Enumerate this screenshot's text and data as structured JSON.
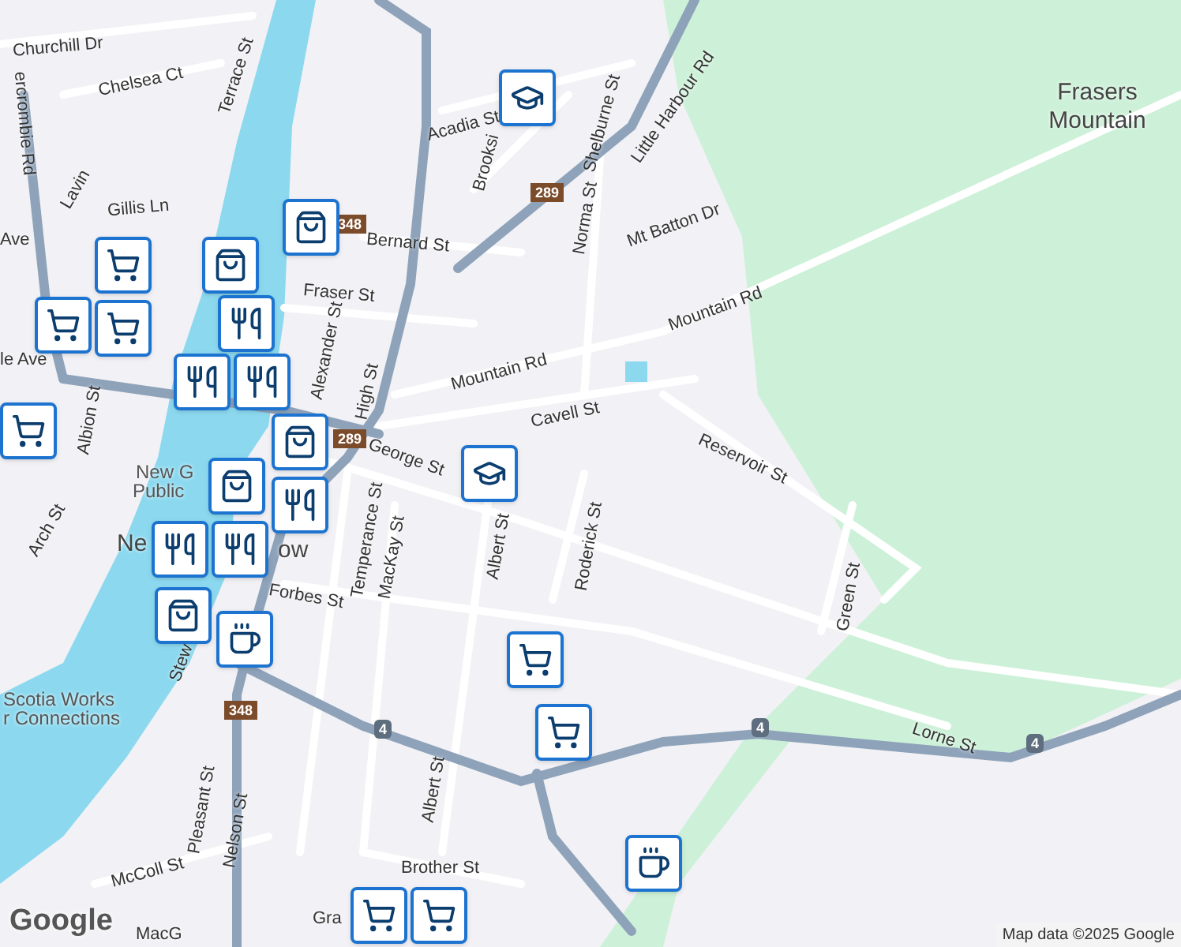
{
  "map": {
    "labels": [
      {
        "text": "Churchill Dr",
        "kind": "street"
      },
      {
        "text": "Chelsea Ct",
        "kind": "street"
      },
      {
        "text": "Terrace St",
        "kind": "street"
      },
      {
        "text": "ercrombie Rd",
        "kind": "street"
      },
      {
        "text": "Acadia St",
        "kind": "street"
      },
      {
        "text": "Brooksi",
        "kind": "street"
      },
      {
        "text": "Shelburne St",
        "kind": "street"
      },
      {
        "text": "Little Harbour Rd",
        "kind": "street"
      },
      {
        "text": "Frasers Mountain",
        "kind": "area"
      },
      {
        "text": "Lavin",
        "kind": "street"
      },
      {
        "text": "Gillis Ln",
        "kind": "street"
      },
      {
        "text": "Ave",
        "kind": "street"
      },
      {
        "text": "Bernard St",
        "kind": "street"
      },
      {
        "text": "Norma St",
        "kind": "street"
      },
      {
        "text": "Mt Batton Dr",
        "kind": "street"
      },
      {
        "text": "Fraser St",
        "kind": "street"
      },
      {
        "text": "Mountain Rd",
        "kind": "street"
      },
      {
        "text": "Mountain Rd",
        "kind": "street"
      },
      {
        "text": "Alexander St",
        "kind": "street"
      },
      {
        "text": "High St",
        "kind": "street"
      },
      {
        "text": "Cavell St",
        "kind": "street"
      },
      {
        "text": "Reservoir St",
        "kind": "street"
      },
      {
        "text": "George St",
        "kind": "street"
      },
      {
        "text": "Temperance St",
        "kind": "street"
      },
      {
        "text": "MacKay St",
        "kind": "street"
      },
      {
        "text": "Albert St",
        "kind": "street"
      },
      {
        "text": "Roderick St",
        "kind": "street"
      },
      {
        "text": "Forbes St",
        "kind": "street"
      },
      {
        "text": "Green St",
        "kind": "street"
      },
      {
        "text": "le Ave",
        "kind": "street"
      },
      {
        "text": "Albion St",
        "kind": "street"
      },
      {
        "text": "Arch St",
        "kind": "street"
      },
      {
        "text": "New G",
        "kind": "poi"
      },
      {
        "text": "Public",
        "kind": "poi"
      },
      {
        "text": "Ne",
        "kind": "place"
      },
      {
        "text": "ow",
        "kind": "place"
      },
      {
        "text": "Stew",
        "kind": "street"
      },
      {
        "text": "Scotia Works",
        "kind": "poi"
      },
      {
        "text": "r Connections",
        "kind": "poi"
      },
      {
        "text": "Lorne St",
        "kind": "street"
      },
      {
        "text": "Albert St",
        "kind": "street"
      },
      {
        "text": "Brother St",
        "kind": "street"
      },
      {
        "text": "Pleasant St",
        "kind": "street"
      },
      {
        "text": "Nelson St",
        "kind": "street"
      },
      {
        "text": "McColl St",
        "kind": "street"
      },
      {
        "text": "Gra",
        "kind": "street"
      },
      {
        "text": "MacG",
        "kind": "street"
      }
    ],
    "shields": [
      {
        "text": "348",
        "kind": "route"
      },
      {
        "text": "289",
        "kind": "route"
      },
      {
        "text": "289",
        "kind": "route"
      },
      {
        "text": "348",
        "kind": "route"
      },
      {
        "text": "4",
        "kind": "highway"
      },
      {
        "text": "4",
        "kind": "highway"
      },
      {
        "text": "4",
        "kind": "highway"
      }
    ],
    "markers": [
      {
        "kind": "school"
      },
      {
        "kind": "shop"
      },
      {
        "kind": "cart"
      },
      {
        "kind": "cart"
      },
      {
        "kind": "cart"
      },
      {
        "kind": "shop"
      },
      {
        "kind": "food"
      },
      {
        "kind": "food"
      },
      {
        "kind": "food"
      },
      {
        "kind": "cart"
      },
      {
        "kind": "shop"
      },
      {
        "kind": "school"
      },
      {
        "kind": "food"
      },
      {
        "kind": "shop"
      },
      {
        "kind": "food"
      },
      {
        "kind": "food"
      },
      {
        "kind": "shop"
      },
      {
        "kind": "cafe"
      },
      {
        "kind": "cart"
      },
      {
        "kind": "cart"
      },
      {
        "kind": "cafe"
      },
      {
        "kind": "cart"
      },
      {
        "kind": "cart"
      }
    ],
    "logo": "Google",
    "attribution": "Map data ©2025 Google"
  }
}
